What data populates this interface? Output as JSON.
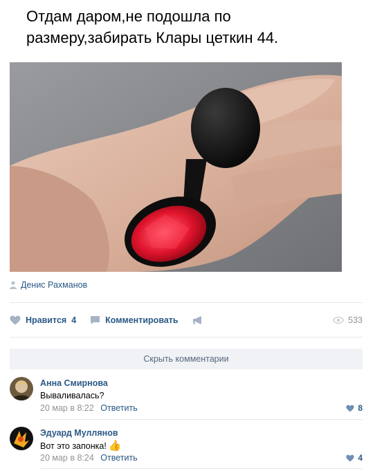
{
  "post": {
    "text": "Отдам даром,не подошла по размеру,забирать Клары цеткин 44.",
    "author": "Денис Рахманов"
  },
  "actions": {
    "like_label": "Нравится",
    "like_count": "4",
    "comment_label": "Комментировать",
    "views": "533"
  },
  "comments_toggle": "Скрыть комментарии",
  "comments": [
    {
      "name": "Анна Смирнова",
      "text": "Вываливалась?",
      "date": "20 мар в 8:22",
      "reply": "Ответить",
      "likes": "8"
    },
    {
      "name": "Эдуард Муллянов",
      "text": "Вот это запонка!",
      "emoji": "👍",
      "date": "20 мар в 8:24",
      "reply": "Ответить",
      "likes": "4"
    }
  ],
  "colors": {
    "link": "#2a5885",
    "muted": "#939393",
    "divider": "#e7e8ec",
    "button_bg": "#f0f2f5"
  },
  "icons": [
    "person-icon",
    "heart-icon",
    "comment-icon",
    "megaphone-icon",
    "eye-icon",
    "thumbs-up-emoji"
  ]
}
